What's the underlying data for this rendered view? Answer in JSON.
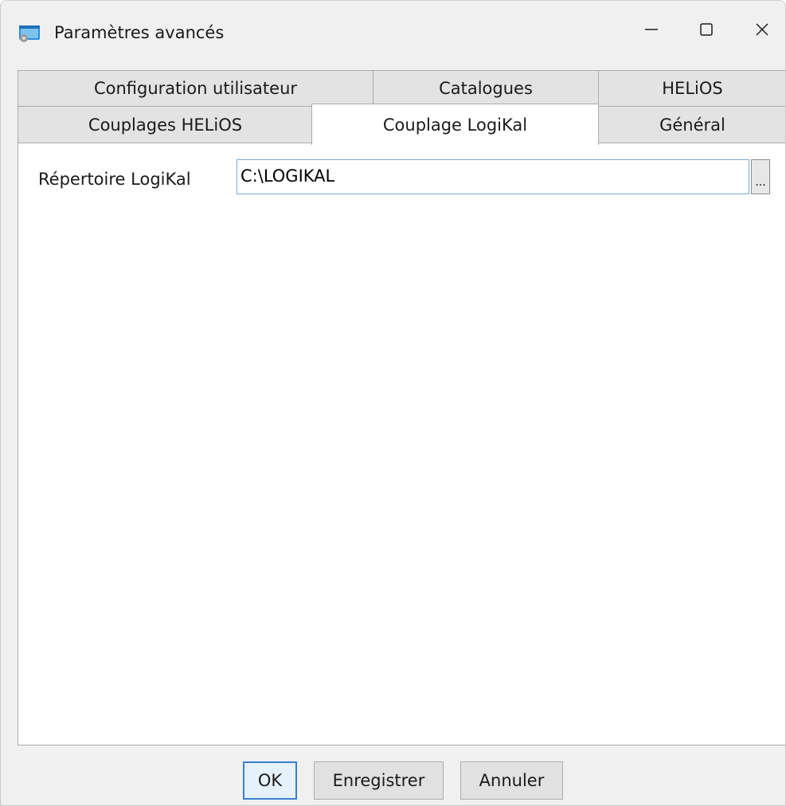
{
  "window": {
    "title": "Paramètres avancés",
    "icon": "app-window-icon",
    "controls": {
      "minimize": "minimize-icon",
      "maximize": "maximize-icon",
      "close": "close-icon"
    }
  },
  "tabs": {
    "row1": [
      {
        "label": "Configuration utilisateur"
      },
      {
        "label": "Catalogues"
      },
      {
        "label": "HELiOS"
      }
    ],
    "row2": [
      {
        "label": "Couplages HELiOS"
      },
      {
        "label": "Couplage LogiKal",
        "selected": true
      },
      {
        "label": "Général"
      }
    ]
  },
  "panel": {
    "directory_label": "Répertoire LogiKal",
    "directory_value": "C:\\LOGIKAL",
    "browse_label": "..."
  },
  "buttons": {
    "ok": "OK",
    "save": "Enregistrer",
    "cancel": "Annuler"
  },
  "colors": {
    "accent": "#3c7fd1",
    "background": "#f0f0f0"
  }
}
